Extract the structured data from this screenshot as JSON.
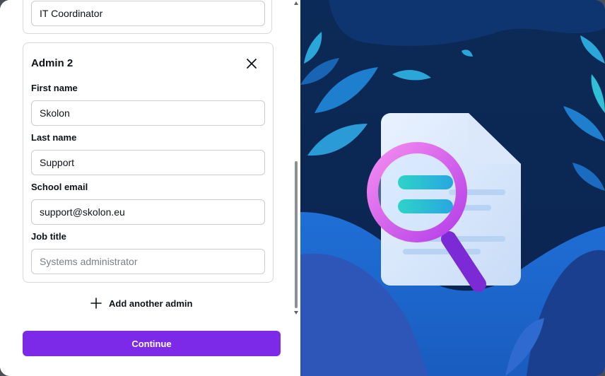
{
  "previous_admin": {
    "job_title_value": "IT Coordinator"
  },
  "admin_card": {
    "title": "Admin 2",
    "first_name": {
      "label": "First name",
      "value": "Skolon"
    },
    "last_name": {
      "label": "Last name",
      "value": "Support"
    },
    "school_email": {
      "label": "School email",
      "value": "support@skolon.eu"
    },
    "job_title": {
      "label": "Job title",
      "value": "",
      "placeholder": "Systems administrator"
    }
  },
  "actions": {
    "add_admin_label": "Add another admin",
    "continue_label": "Continue"
  },
  "icons": {
    "close": "close-icon",
    "add": "plus-icon"
  },
  "colors": {
    "primary": "#7d2ae8",
    "illustration_bg": "#0b2a5b"
  }
}
